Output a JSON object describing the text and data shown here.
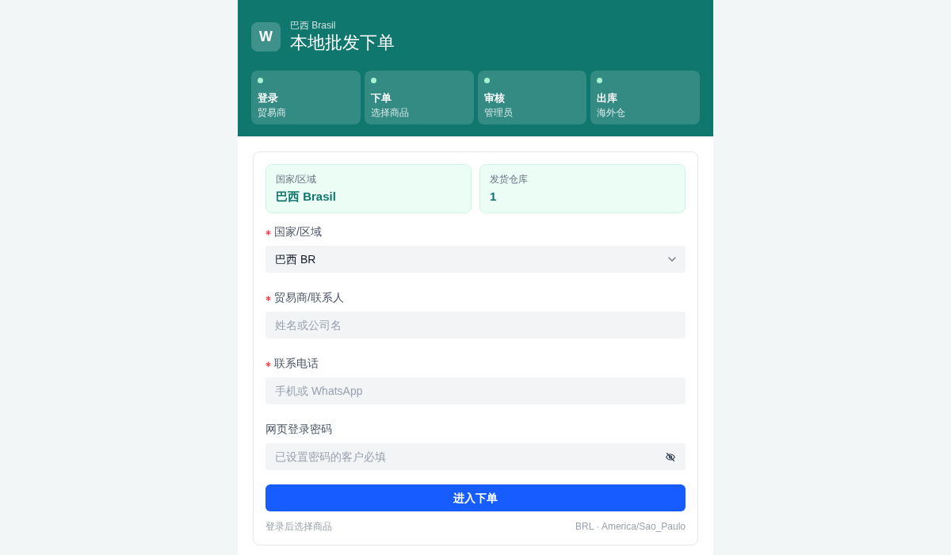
{
  "header": {
    "logo_letter": "W",
    "subtitle": "巴西 Brasil",
    "title": "本地批发下单"
  },
  "steps": [
    {
      "title": "登录",
      "subtitle": "贸易商"
    },
    {
      "title": "下单",
      "subtitle": "选择商品"
    },
    {
      "title": "审核",
      "subtitle": "管理员"
    },
    {
      "title": "出库",
      "subtitle": "海外仓"
    }
  ],
  "summary": [
    {
      "label": "国家/区域",
      "value": "巴西 Brasil"
    },
    {
      "label": "发货仓库",
      "value": "1"
    }
  ],
  "fields": [
    {
      "kind": "select",
      "label": "国家/区域",
      "required": true,
      "value": "巴西 BR"
    },
    {
      "kind": "text",
      "label": "贸易商/联系人",
      "required": true,
      "placeholder": "姓名或公司名"
    },
    {
      "kind": "text",
      "label": "联系电话",
      "required": true,
      "placeholder": "手机或 WhatsApp"
    },
    {
      "kind": "password",
      "label": "网页登录密码",
      "required": false,
      "placeholder": "已设置密码的客户必填"
    }
  ],
  "submit_button": "进入下单",
  "footer": {
    "hint": "登录后选择商品",
    "locale": "BRL · America/Sao_Paulo"
  }
}
